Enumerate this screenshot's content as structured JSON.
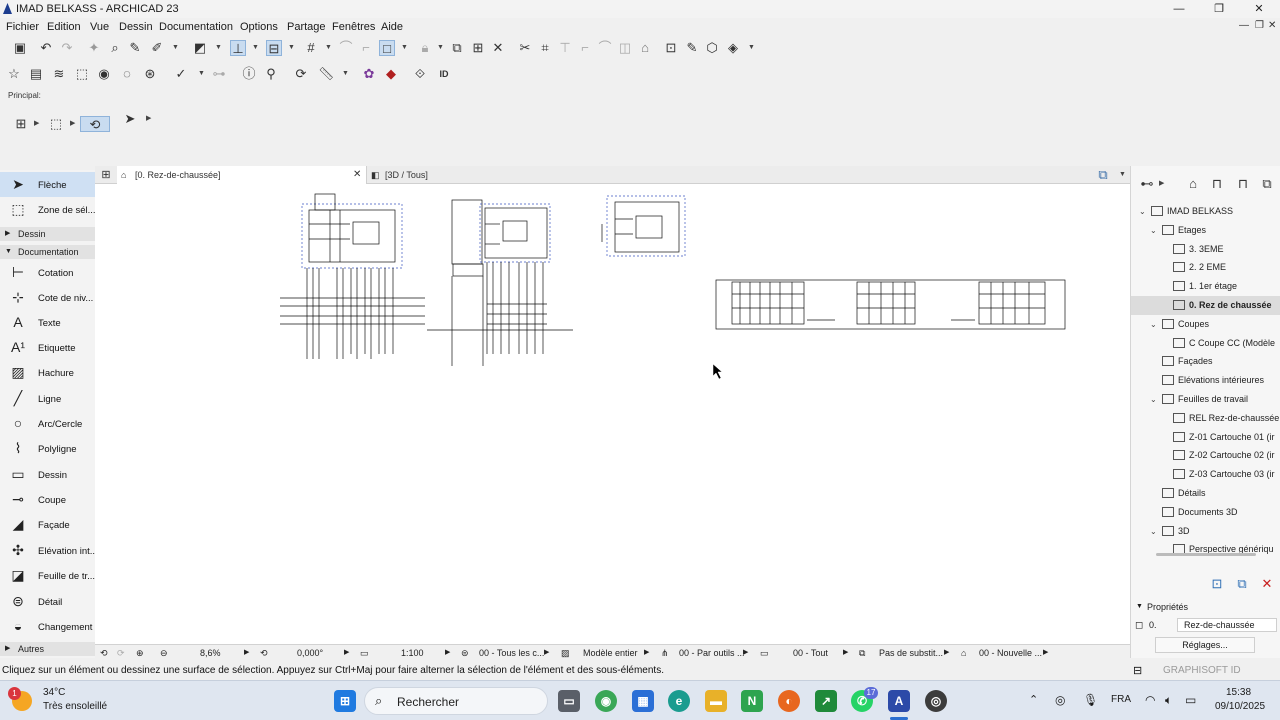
{
  "window": {
    "title": "IMAD BELKASS - ARCHICAD 23",
    "minimize_label": "—",
    "restore_label": "❐",
    "close_label": "✕"
  },
  "menu": [
    "Fichier",
    "Edition",
    "Vue",
    "Dessin",
    "Documentation",
    "Options",
    "Partage",
    "Fenêtres",
    "Aide"
  ],
  "infobox_label": "Principal:",
  "toolbox": {
    "arrow": "Flèche",
    "marquee": "Zone de sél...",
    "section_dessin": "Dessin",
    "section_documentation": "Documentation",
    "tools": [
      "Cotation",
      "Cote de niv...",
      "Texte",
      "Etiquette",
      "Hachure",
      "Ligne",
      "Arc/Cercle",
      "Polyligne",
      "Dessin",
      "Coupe",
      "Façade",
      "Elévation int...",
      "Feuille de tr...",
      "Détail",
      "Changement"
    ],
    "section_autres": "Autres"
  },
  "tabs": [
    {
      "label": "[0. Rez-de-chaussée]",
      "close": "✕"
    },
    {
      "label": "[3D / Tous]"
    }
  ],
  "navigator": {
    "items": [
      {
        "label": "IMAD BELKASS",
        "level": 0,
        "expanded": true,
        "icon": "project-icon"
      },
      {
        "label": "Etages",
        "level": 1,
        "expanded": true,
        "icon": "stories-icon"
      },
      {
        "label": "3. 3EME",
        "level": 2,
        "icon": "story-icon"
      },
      {
        "label": "2. 2 EME",
        "level": 2,
        "icon": "story-icon"
      },
      {
        "label": "1. 1er étage",
        "level": 2,
        "icon": "story-icon"
      },
      {
        "label": "0. Rez de chaussée",
        "level": 2,
        "icon": "story-icon",
        "selected": true
      },
      {
        "label": "Coupes",
        "level": 1,
        "expanded": true,
        "icon": "sections-icon"
      },
      {
        "label": "C Coupe CC (Modèle",
        "level": 2,
        "icon": "section-icon"
      },
      {
        "label": "Façades",
        "level": 1,
        "icon": "elevation-icon"
      },
      {
        "label": "Elévations intérieures",
        "level": 1,
        "icon": "interior-elevation-icon"
      },
      {
        "label": "Feuilles de travail",
        "level": 1,
        "expanded": true,
        "icon": "worksheet-icon"
      },
      {
        "label": "REL Rez-de-chaussée",
        "level": 2,
        "icon": "worksheet-icon"
      },
      {
        "label": "Z-01 Cartouche 01 (ir",
        "level": 2,
        "icon": "worksheet-icon"
      },
      {
        "label": "Z-02 Cartouche 02 (ir",
        "level": 2,
        "icon": "worksheet-icon"
      },
      {
        "label": "Z-03 Cartouche 03 (ir",
        "level": 2,
        "icon": "worksheet-icon"
      },
      {
        "label": "Détails",
        "level": 1,
        "icon": "details-icon"
      },
      {
        "label": "Documents 3D",
        "level": 1,
        "icon": "3d-documents-icon"
      },
      {
        "label": "3D",
        "level": 1,
        "expanded": true,
        "icon": "3d-icon"
      },
      {
        "label": "Perspective génériqu",
        "level": 2,
        "icon": "perspective-icon"
      }
    ]
  },
  "properties": {
    "header": "Propriétés",
    "story_number": "0.",
    "story_name": "Rez-de-chaussée",
    "settings_button": "Réglages..."
  },
  "quick_options": {
    "zoom": "8,6%",
    "angle": "0,000°",
    "scale": "1:100",
    "layer_combo": "00 - Tous les c...",
    "model_view": "Modèle entier",
    "pen_set": "00 - Par outils ...",
    "dimension": "00 - Tout",
    "override": "Pas de substit...",
    "renovation": "00 - Nouvelle ..."
  },
  "status_text": "Cliquez sur un élément ou dessinez une surface de sélection. Appuyez sur Ctrl+Maj pour faire alterner la sélection de l'élément et des sous-éléments.",
  "graphisoft_label": "GRAPHISOFT ID",
  "taskbar": {
    "weather_temp": "34°C",
    "weather_desc": "Très ensoleillé",
    "weather_badge": "1",
    "search_placeholder": "Rechercher",
    "language": "FRA",
    "time": "15:38",
    "date": "09/10/2025",
    "whatsapp_badge": "17"
  }
}
